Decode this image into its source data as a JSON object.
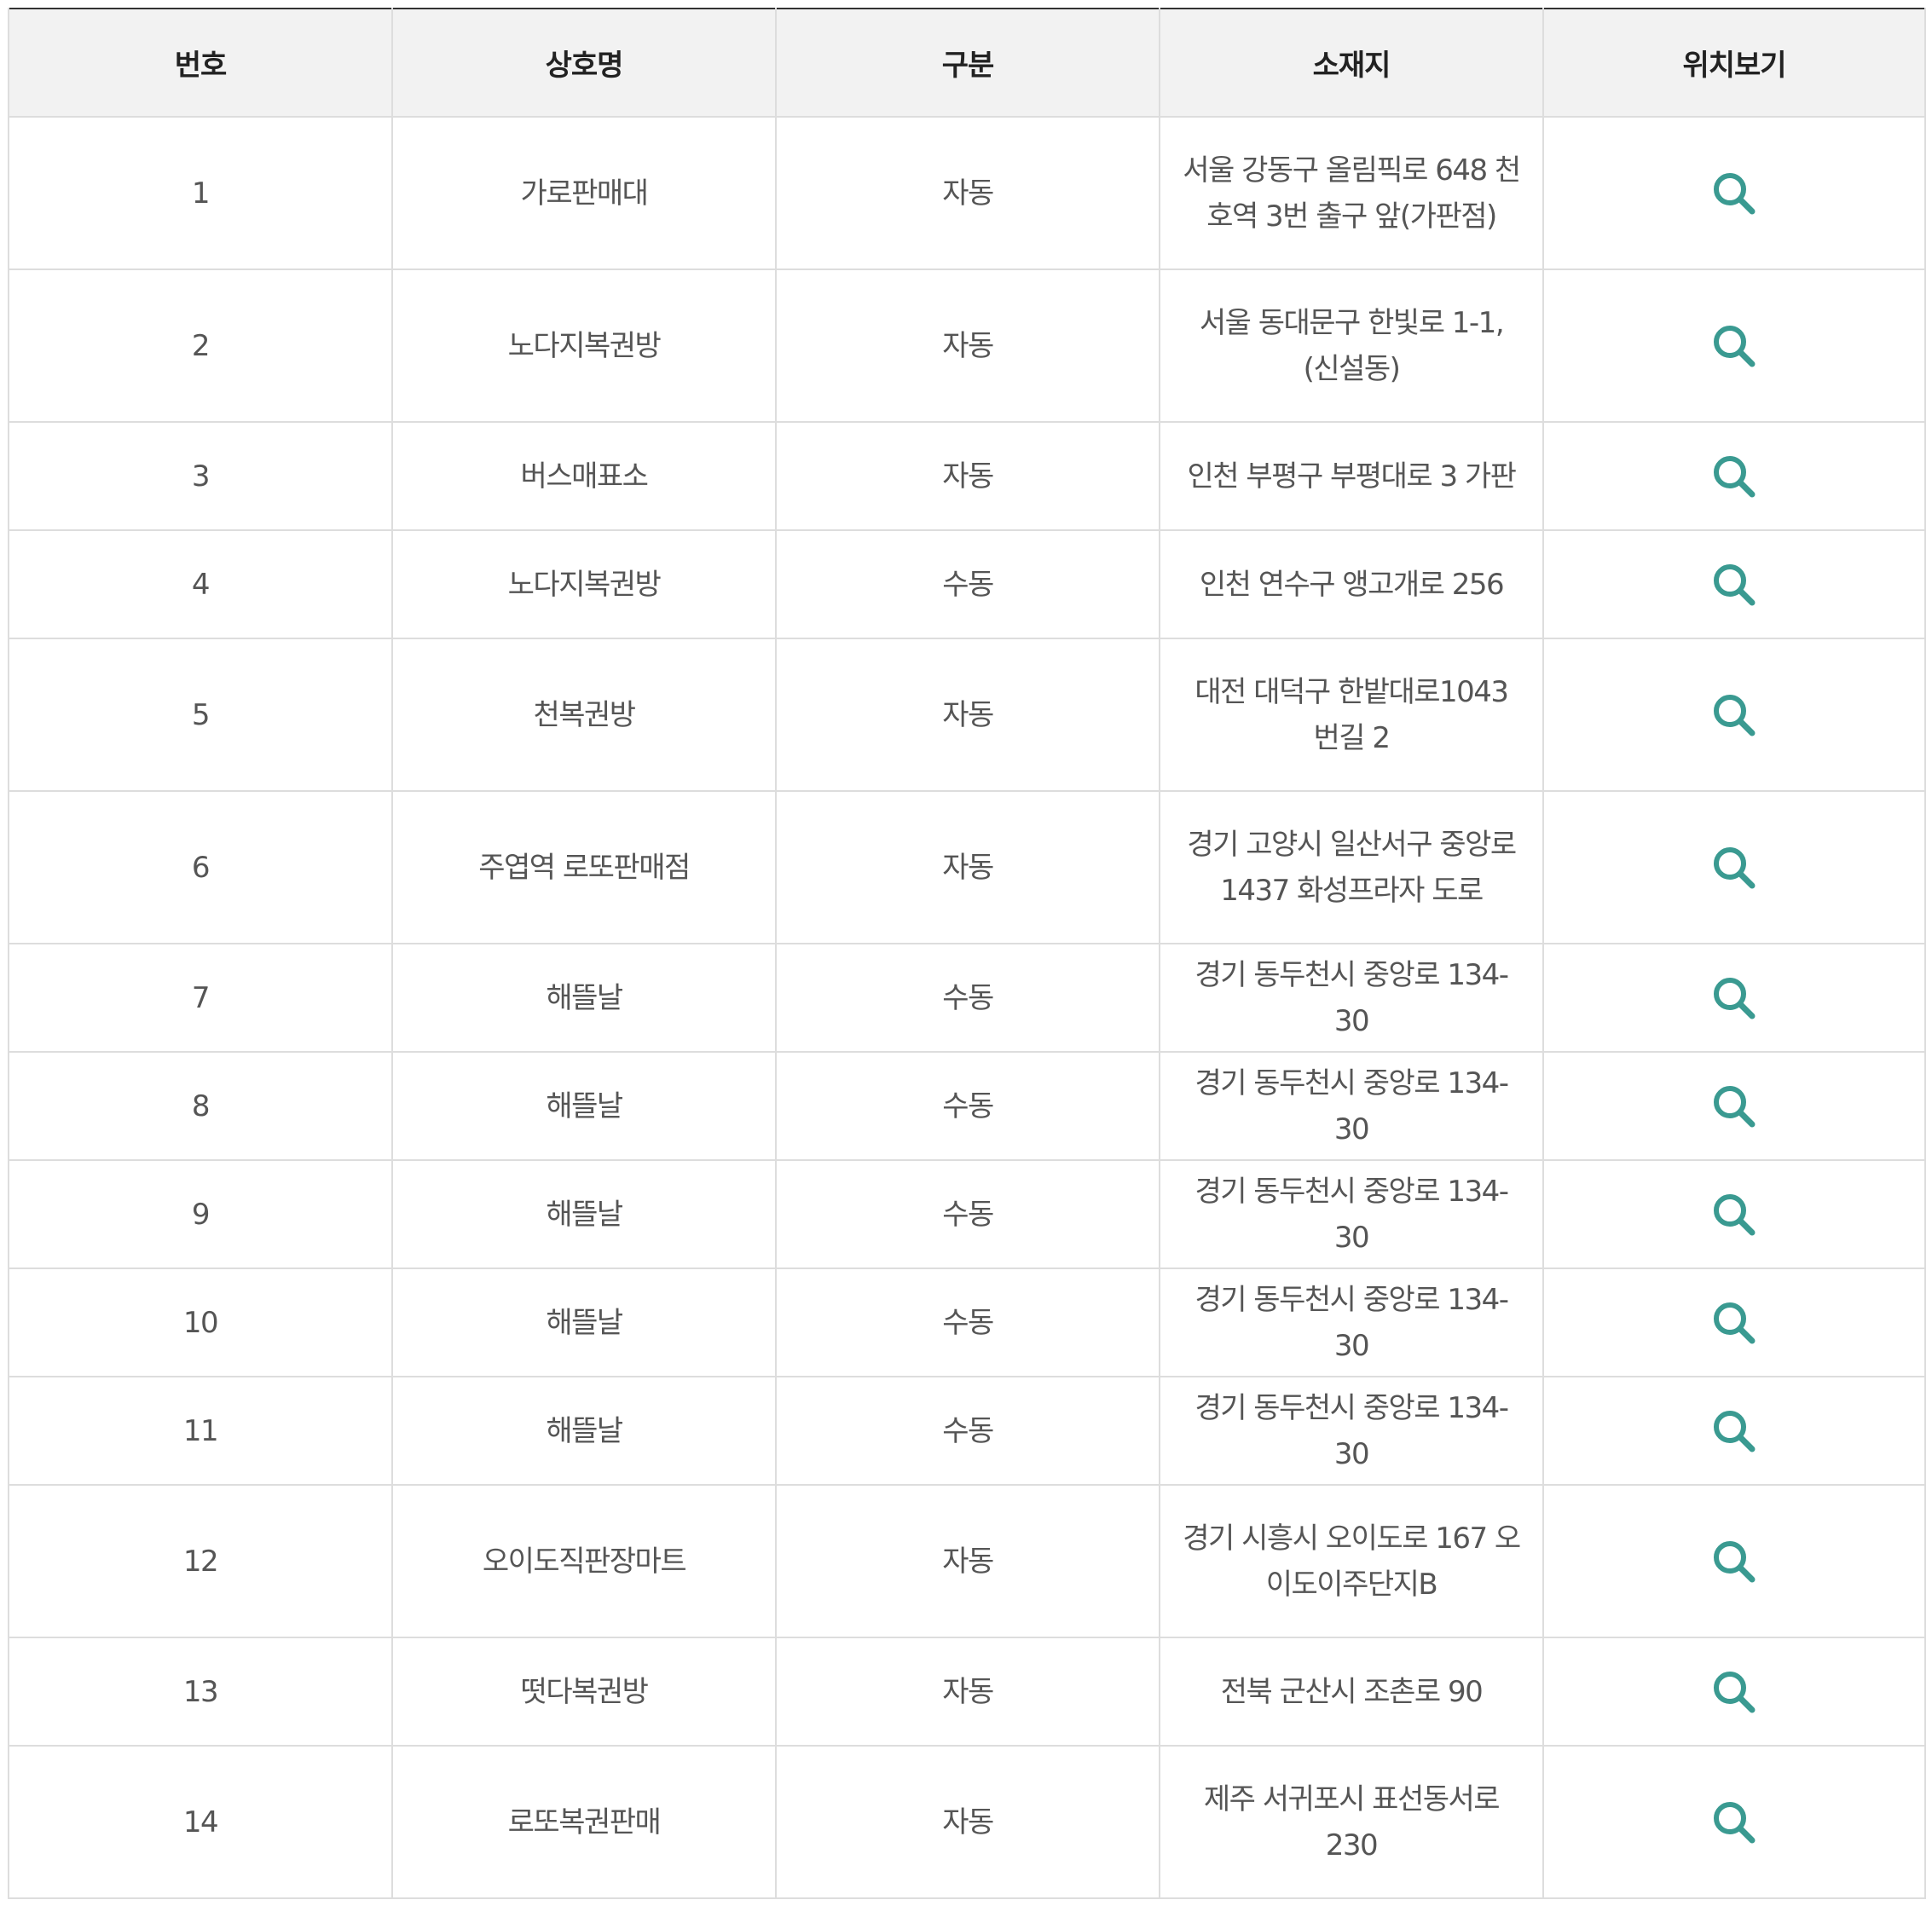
{
  "table": {
    "headers": {
      "number": "번호",
      "name": "상호명",
      "type": "구분",
      "address": "소재지",
      "map": "위치보기"
    },
    "rows": [
      {
        "number": "1",
        "name": "가로판매대",
        "type": "자동",
        "address": "서울 강동구 올림픽로 648 천호역 3번 출구 앞(가판점)"
      },
      {
        "number": "2",
        "name": "노다지복권방",
        "type": "자동",
        "address": "서울 동대문구 한빛로 1-1,(신설동)"
      },
      {
        "number": "3",
        "name": "버스매표소",
        "type": "자동",
        "address": "인천 부평구 부평대로 3 가판"
      },
      {
        "number": "4",
        "name": "노다지복권방",
        "type": "수동",
        "address": "인천 연수구 앵고개로 256"
      },
      {
        "number": "5",
        "name": "천복권방",
        "type": "자동",
        "address": "대전 대덕구 한밭대로1043번길 2"
      },
      {
        "number": "6",
        "name": "주엽역 로또판매점",
        "type": "자동",
        "address": "경기 고양시 일산서구 중앙로 1437 화성프라자 도로"
      },
      {
        "number": "7",
        "name": "해뜰날",
        "type": "수동",
        "address": "경기 동두천시 중앙로 134-30"
      },
      {
        "number": "8",
        "name": "해뜰날",
        "type": "수동",
        "address": "경기 동두천시 중앙로 134-30"
      },
      {
        "number": "9",
        "name": "해뜰날",
        "type": "수동",
        "address": "경기 동두천시 중앙로 134-30"
      },
      {
        "number": "10",
        "name": "해뜰날",
        "type": "수동",
        "address": "경기 동두천시 중앙로 134-30"
      },
      {
        "number": "11",
        "name": "해뜰날",
        "type": "수동",
        "address": "경기 동두천시 중앙로 134-30"
      },
      {
        "number": "12",
        "name": "오이도직판장마트",
        "type": "자동",
        "address": "경기 시흥시 오이도로 167 오이도이주단지B"
      },
      {
        "number": "13",
        "name": "떳다복권방",
        "type": "자동",
        "address": "전북 군산시 조촌로 90"
      },
      {
        "number": "14",
        "name": "로또복권판매",
        "type": "자동",
        "address": "제주 서귀포시 표선동서로 230"
      }
    ],
    "map_icon": "search-icon",
    "accent_color": "#3a9a91"
  }
}
